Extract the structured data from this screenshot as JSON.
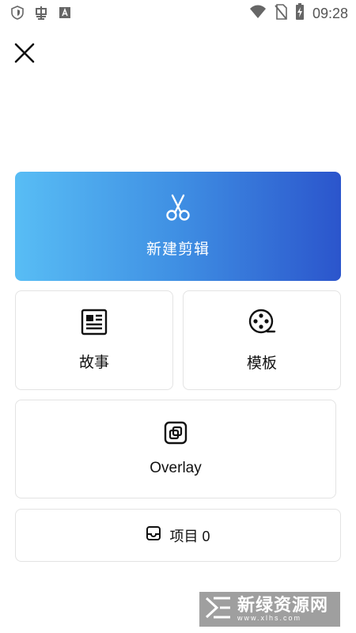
{
  "status_bar": {
    "time": "09:28",
    "left_icons": [
      "shield-icon",
      "bug-icon",
      "font-a-icon"
    ],
    "right_icons": [
      "wifi-icon",
      "no-sim-icon",
      "battery-charging-icon"
    ]
  },
  "header": {
    "close_icon": "close-icon"
  },
  "actions": {
    "new_edit": {
      "label": "新建剪辑",
      "icon": "scissors-icon"
    },
    "story": {
      "label": "故事",
      "icon": "article-icon"
    },
    "template": {
      "label": "模板",
      "icon": "film-reel-icon"
    },
    "overlay": {
      "label": "Overlay",
      "icon": "overlay-icon"
    },
    "projects": {
      "label": "项目 0",
      "icon": "inbox-icon"
    }
  },
  "watermark": {
    "text": "新绿资源网",
    "sub": "www.xlhs.com"
  },
  "colors": {
    "gradient_start": "#58bdf5",
    "gradient_end": "#2b55cc",
    "card_border": "#e3e3e3"
  }
}
